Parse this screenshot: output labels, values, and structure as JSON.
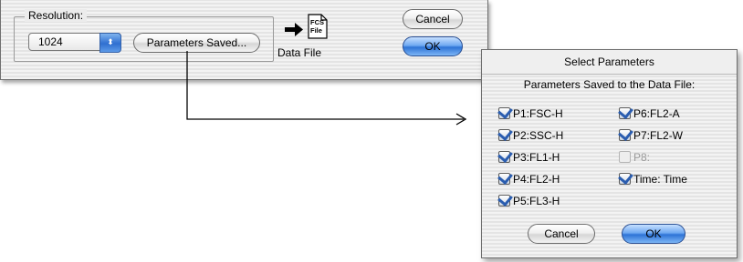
{
  "main_dialog": {
    "resolution_label": "Resolution:",
    "resolution_value": "1024",
    "stepper_glyph": "⬍",
    "params_saved_button": "Parameters Saved...",
    "fcs_icon_text_top": "FCS",
    "fcs_icon_text_bottom": "File",
    "data_file_label": "Data File",
    "cancel_button": "Cancel",
    "ok_button": "OK"
  },
  "select_dialog": {
    "title": "Select Parameters",
    "subtitle": "Parameters Saved to the Data File:",
    "left_params": [
      {
        "label": "P1:FSC-H",
        "checked": true
      },
      {
        "label": "P2:SSC-H",
        "checked": true
      },
      {
        "label": "P3:FL1-H",
        "checked": true
      },
      {
        "label": "P4:FL2-H",
        "checked": true
      },
      {
        "label": "P5:FL3-H",
        "checked": true
      }
    ],
    "right_params": [
      {
        "label": "P6:FL2-A",
        "checked": true
      },
      {
        "label": "P7:FL2-W",
        "checked": true
      },
      {
        "label": "P8:",
        "checked": false,
        "disabled": true
      },
      {
        "label": "Time: Time",
        "checked": true
      }
    ],
    "cancel_button": "Cancel",
    "ok_button": "OK"
  },
  "colors": {
    "default_button": "#2e73d6",
    "checkmark": "#2a5db0",
    "connector_line": "#000000"
  },
  "icons": {
    "arrow": "right-arrow-icon",
    "fcs_file": "fcs-file-icon",
    "checkbox": "checkbox-icon"
  }
}
